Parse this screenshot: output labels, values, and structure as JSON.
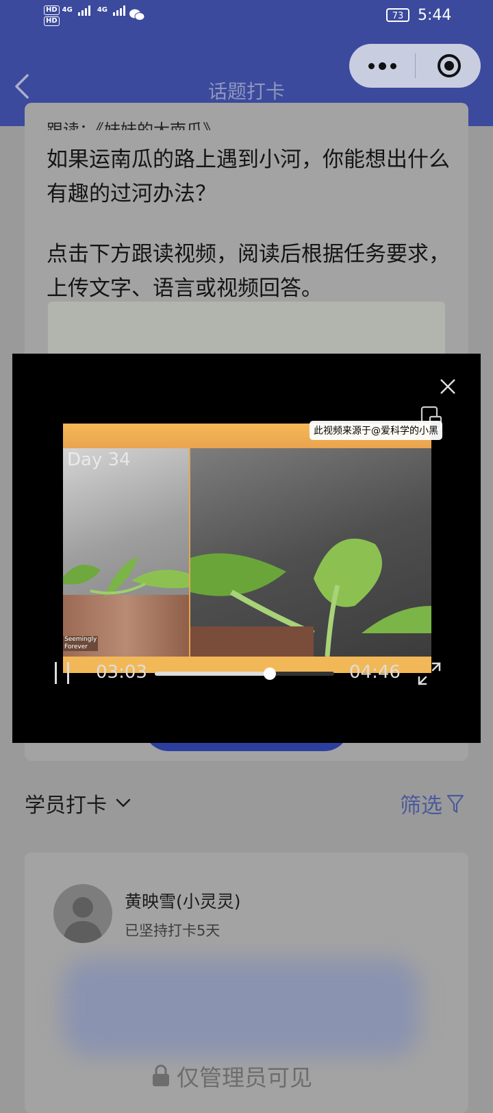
{
  "status_bar": {
    "hd1": "HD",
    "hd2": "HD",
    "network1": "4G",
    "network2": "4G",
    "battery": "73",
    "time": "5:44"
  },
  "nav": {
    "title": "话题打卡"
  },
  "post": {
    "follow_label": "跟读：《妹妹的大南瓜》",
    "question": "如果运南瓜的路上遇到小河，你能想出什么有趣的过河办法？",
    "instruction": "点击下方跟读视频，阅读后根据任务要求，上传文字、语言或视频回答。"
  },
  "video": {
    "source_label": "此视频来源于@爱科学的小黑",
    "day_label": "Day 34",
    "watermark_line1": "Seemingly",
    "watermark_line2": "Forever",
    "current_time": "03:03",
    "total_time": "04:46",
    "progress": 0.64
  },
  "checkins": {
    "title": "学员打卡",
    "filter_label": "筛选"
  },
  "entry": {
    "name": "黄映雪(小灵灵)",
    "streak": "已坚持打卡5天",
    "private_label": "仅管理员可见"
  },
  "colors": {
    "nav_bg": "#3b4a9c",
    "filter_text": "#4b5a9c",
    "overlay_bg": "#000000"
  }
}
